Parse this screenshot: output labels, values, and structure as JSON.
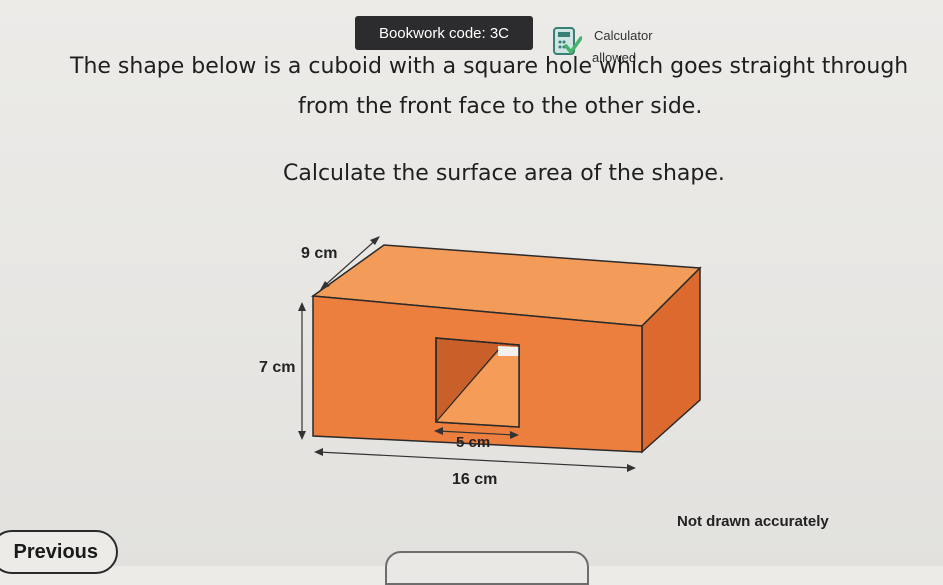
{
  "header": {
    "bookwork_code": "Bookwork code: 3C",
    "calculator_line1": "Calculator",
    "calculator_line2": "allowed"
  },
  "question": {
    "line1": "The shape below is a cuboid with a square hole which goes straight through",
    "line2": "from the front face to the other side.",
    "line3": "Calculate the surface area of the shape."
  },
  "figure": {
    "depth_label": "9 cm",
    "height_label": "7 cm",
    "hole_label": "5 cm",
    "length_label": "16 cm",
    "note": "Not drawn accurately",
    "colors": {
      "top_face": "#f39b59",
      "front_face": "#ec7f3e",
      "side_face": "#dc6a2e",
      "edge": "#2a2a2a"
    }
  },
  "nav": {
    "previous_label": "Previous"
  }
}
